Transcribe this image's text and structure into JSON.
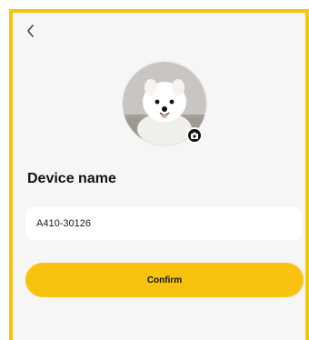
{
  "colors": {
    "accent": "#f7c30f",
    "background": "#f6f6f7"
  },
  "header": {
    "back_icon": "chevron-left-icon"
  },
  "avatar": {
    "icon": "camera-icon"
  },
  "device": {
    "label": "Device name",
    "value": "A410-30126"
  },
  "actions": {
    "confirm_label": "Confirm"
  }
}
